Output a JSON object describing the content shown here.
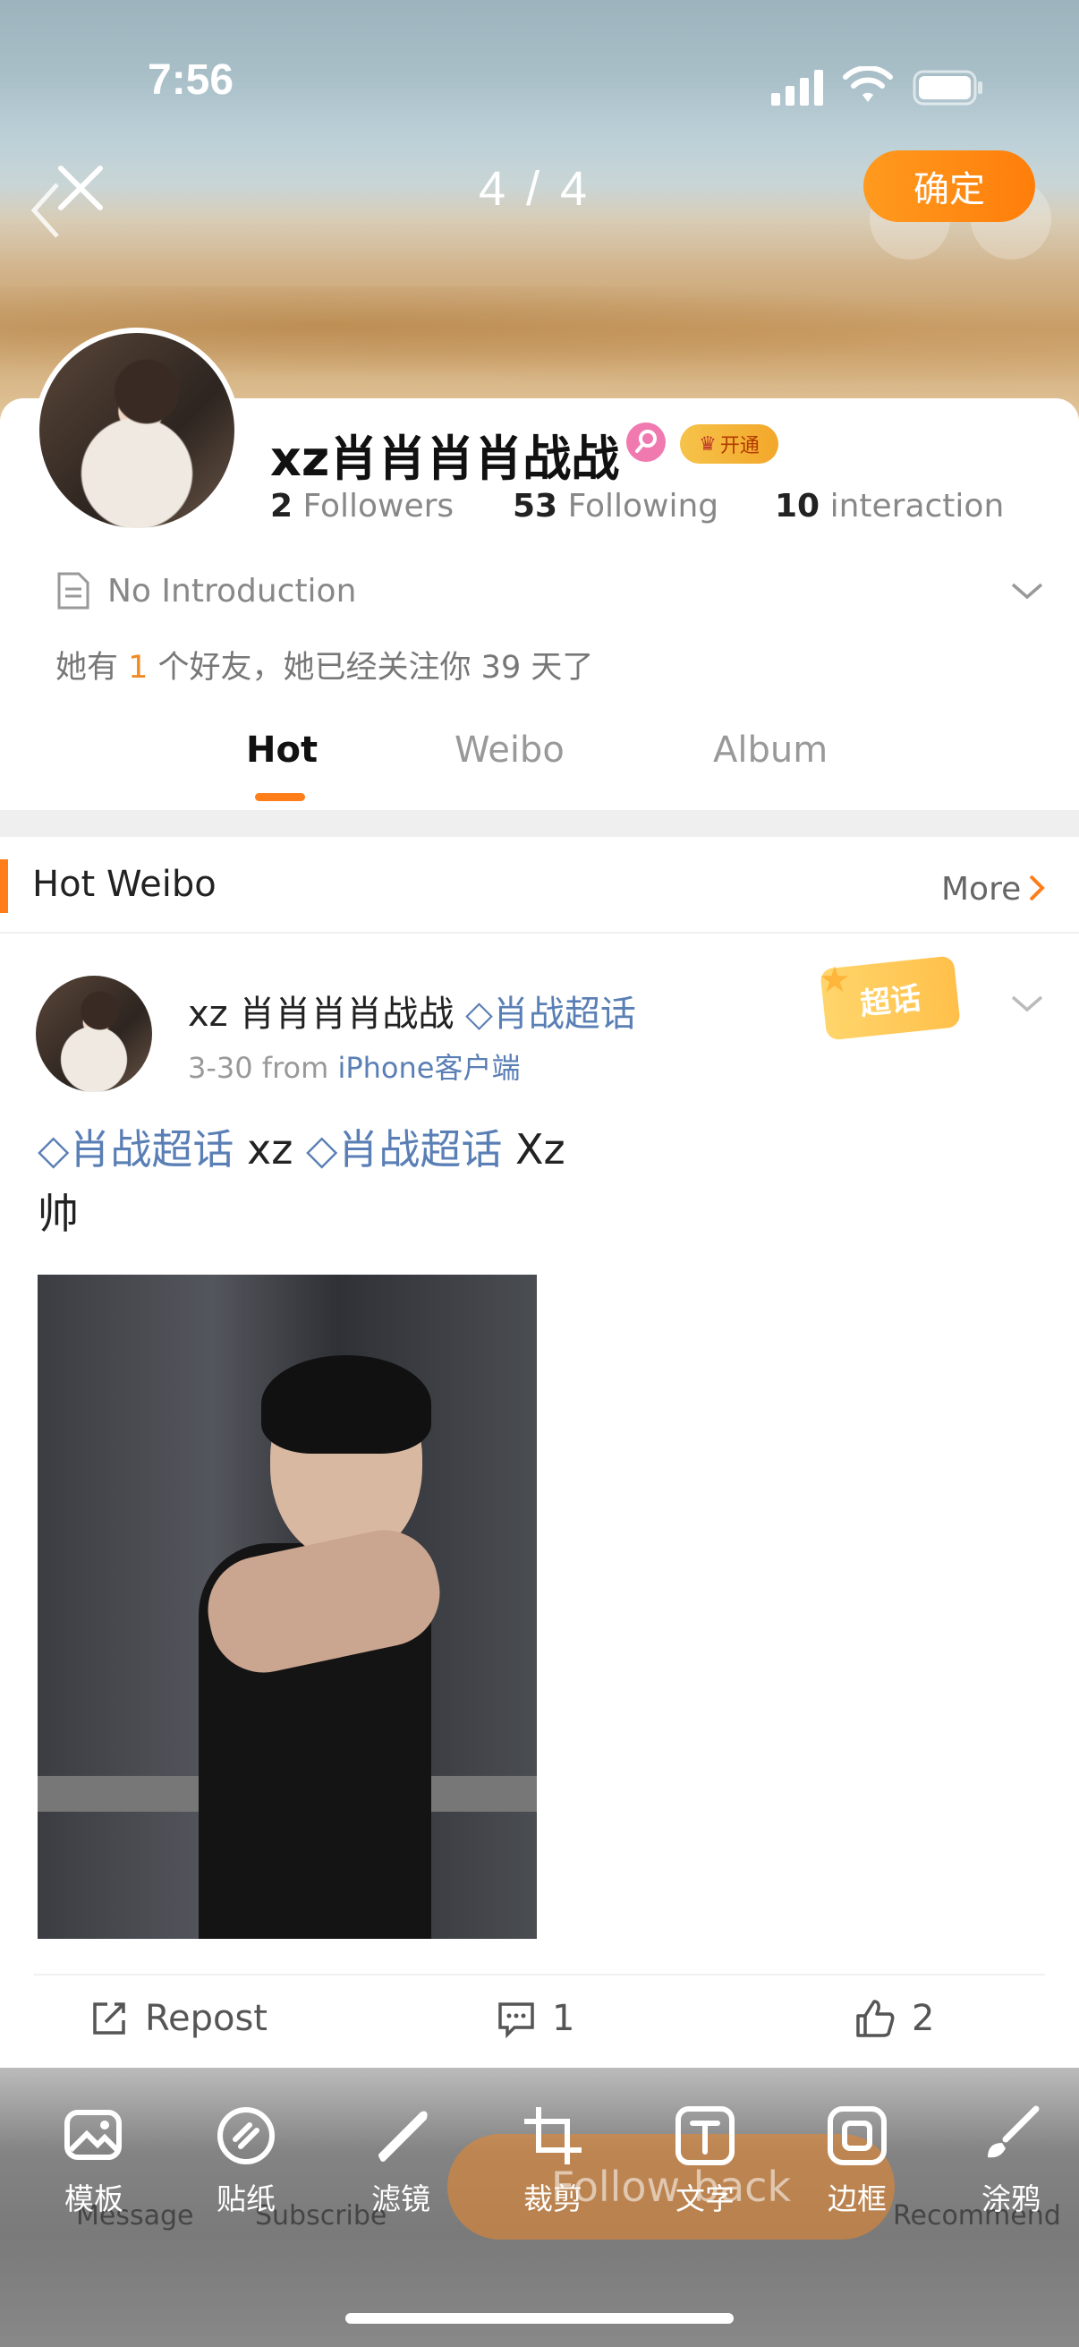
{
  "status": {
    "time": "7:56"
  },
  "editor": {
    "counter": "4 / 4",
    "confirm": "确定"
  },
  "profile": {
    "username": "xz肖肖肖肖战战",
    "vip_label": "开通",
    "followers_count": "2",
    "followers_label": "Followers",
    "following_count": "53",
    "following_label": "Following",
    "interaction_count": "10",
    "interaction_label": "interaction",
    "introduction": "No Introduction",
    "friends_pre": "她有 ",
    "friends_num": "1",
    "friends_post": " 个好友，她已经关注你 39 天了"
  },
  "tabs": [
    {
      "label": "Hot"
    },
    {
      "label": "Weibo"
    },
    {
      "label": "Album"
    }
  ],
  "hot_section": {
    "title": "Hot Weibo",
    "more": "More"
  },
  "post": {
    "author": "xz 肖肖肖肖战战",
    "topic_tag": "肖战超话",
    "date": "3-30",
    "from": "from",
    "source": "iPhone客户端",
    "chaohua_badge": "超话",
    "line1_topic1": "肖战超话",
    "line1_mid": " xz ",
    "line1_topic2": "肖战超话",
    "line1_end": " Xz",
    "line2": "帅",
    "repost": "Repost",
    "comments": "1",
    "likes": "2"
  },
  "background_nav": {
    "message": "Message",
    "subscribe": "Subscribe",
    "follow_back": "Follow back",
    "recommend": "Recommend"
  },
  "tools": [
    {
      "label": "模板"
    },
    {
      "label": "贴纸"
    },
    {
      "label": "滤镜"
    },
    {
      "label": "裁剪"
    },
    {
      "label": "文字"
    },
    {
      "label": "边框"
    },
    {
      "label": "涂鸦"
    }
  ]
}
